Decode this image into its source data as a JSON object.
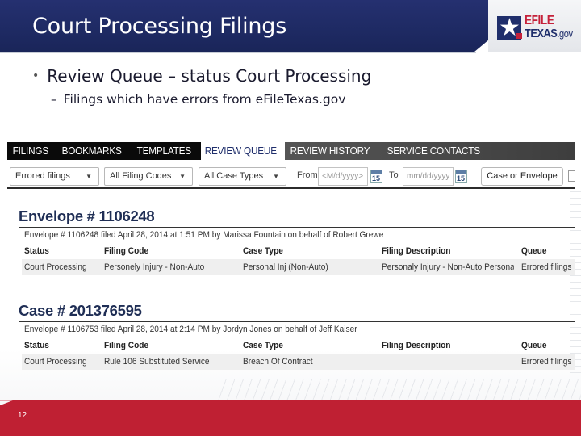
{
  "slide": {
    "title": "Court Processing Filings",
    "page_number": "12",
    "bullets": [
      {
        "level": 1,
        "marker": "•",
        "text": "Review Queue – status Court Processing"
      },
      {
        "level": 2,
        "marker": "–",
        "text": "Filings which have errors from eFileTexas.gov"
      }
    ],
    "logo": {
      "line1": "EFILE",
      "line2": "TEXAS",
      "line2_suffix": ".gov"
    },
    "colors": {
      "header_navy": "#1e2a63",
      "footer_red": "#bf2033",
      "title_navy": "#1f2e55"
    }
  },
  "app": {
    "nav": {
      "items": [
        {
          "label": "FILINGS",
          "active": false
        },
        {
          "label": "BOOKMARKS",
          "active": false
        },
        {
          "label": "TEMPLATES",
          "active": false
        },
        {
          "label": "REVIEW QUEUE",
          "active": true
        },
        {
          "label": "REVIEW HISTORY",
          "active": false
        },
        {
          "label": "SERVICE CONTACTS",
          "active": false
        }
      ]
    },
    "filters": {
      "queue_select": "Errored filings",
      "filing_code_select": "All Filing Codes",
      "case_type_select": "All Case Types",
      "from_label": "From",
      "from_placeholder": "<M/d/yyyy>",
      "to_label": "To",
      "to_placeholder": "mm/dd/yyyy",
      "calendar_day": "15",
      "search_button": "Case or Envelope"
    },
    "columns": [
      "Status",
      "Filing Code",
      "Case Type",
      "Filing Description",
      "Queue"
    ],
    "sections": [
      {
        "title": "Envelope # 1106248",
        "filed_text": "Envelope # 1106248 filed April 28, 2014 at 1:51 PM by Marissa Fountain on behalf of Robert Grewe",
        "rows": [
          [
            "Court Processing",
            "Personely Injury - Non-Auto",
            "Personal Inj (Non-Auto)",
            "Personaly Injury - Non-Auto Personaly",
            "Errored filings"
          ]
        ]
      },
      {
        "title": "Case # 201376595",
        "filed_text": "Envelope # 1106753 filed April 28, 2014 at 2:14 PM by Jordyn Jones on behalf of Jeff Kaiser",
        "rows": [
          [
            "Court Processing",
            "Rule 106 Substituted Service",
            "Breach Of Contract",
            "",
            "Errored filings"
          ]
        ]
      }
    ]
  }
}
